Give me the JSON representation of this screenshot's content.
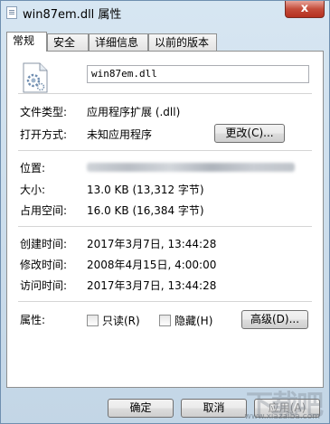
{
  "window": {
    "title": "win87em.dll 属性",
    "close_label": "x"
  },
  "tabs": [
    "常规",
    "安全",
    "详细信息",
    "以前的版本"
  ],
  "general": {
    "filename": "win87em.dll",
    "file_type_label": "文件类型:",
    "file_type_value": "应用程序扩展 (.dll)",
    "open_with_label": "打开方式:",
    "open_with_value": "未知应用程序",
    "change_button": "更改(C)...",
    "location_label": "位置:",
    "size_label": "大小:",
    "size_value": "13.0 KB (13,312 字节)",
    "size_on_disk_label": "占用空间:",
    "size_on_disk_value": "16.0 KB (16,384 字节)",
    "created_label": "创建时间:",
    "created_value": "2017年3月7日, 13:44:28",
    "modified_label": "修改时间:",
    "modified_value": "2008年4月15日, 4:00:00",
    "accessed_label": "访问时间:",
    "accessed_value": "2017年3月7日, 13:44:28",
    "attributes_label": "属性:",
    "readonly_label": "只读(R)",
    "hidden_label": "隐藏(H)",
    "advanced_button": "高级(D)..."
  },
  "buttons": {
    "ok": "确定",
    "cancel": "取消",
    "apply": "应用(A)"
  },
  "watermark": {
    "big": "下载吧",
    "small": "www.xiazaiba.com"
  }
}
